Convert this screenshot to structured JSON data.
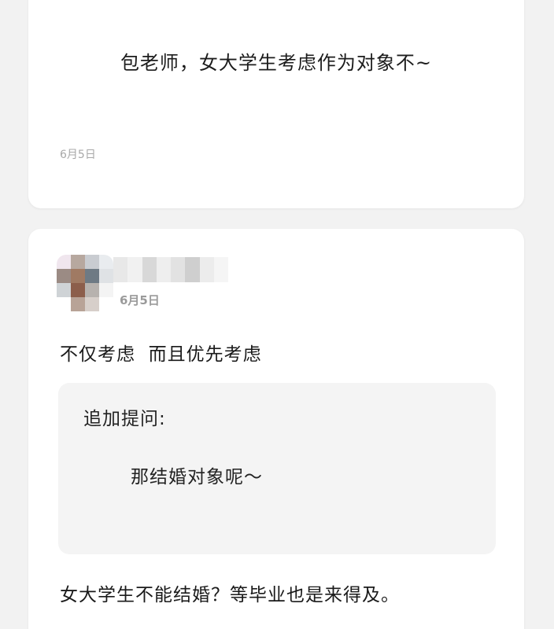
{
  "question": {
    "text": "包老师，女大学生考虑作为对象不~",
    "date": "6月5日"
  },
  "answer": {
    "date": "6月5日",
    "text": "不仅考虑  而且优先考虑",
    "followup_label": "追加提问:",
    "followup_text": "那结婚对象呢～",
    "reply_text": "女大学生不能结婚？等毕业也是来得及。"
  },
  "colors": {
    "background": "#f2f2f2",
    "card": "#ffffff",
    "followup_box": "#f4f4f4",
    "date_text": "#a8a8a8"
  }
}
